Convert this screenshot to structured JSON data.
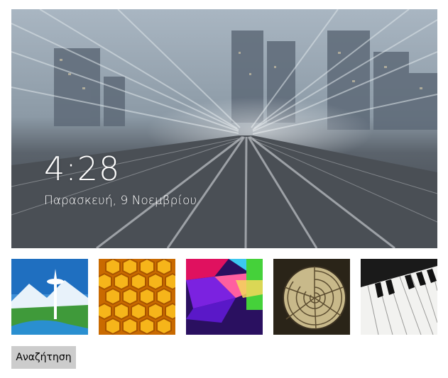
{
  "lockscreen": {
    "time": "4:28",
    "date": "Παρασκευή, 9 Νοεμβρίου"
  },
  "thumbnails": [
    {
      "name": "space-needle-illustration"
    },
    {
      "name": "honeycomb"
    },
    {
      "name": "colorful-geometric"
    },
    {
      "name": "nautilus-shell"
    },
    {
      "name": "piano-keys"
    }
  ],
  "browse_button": {
    "label": "Αναζήτηση"
  }
}
